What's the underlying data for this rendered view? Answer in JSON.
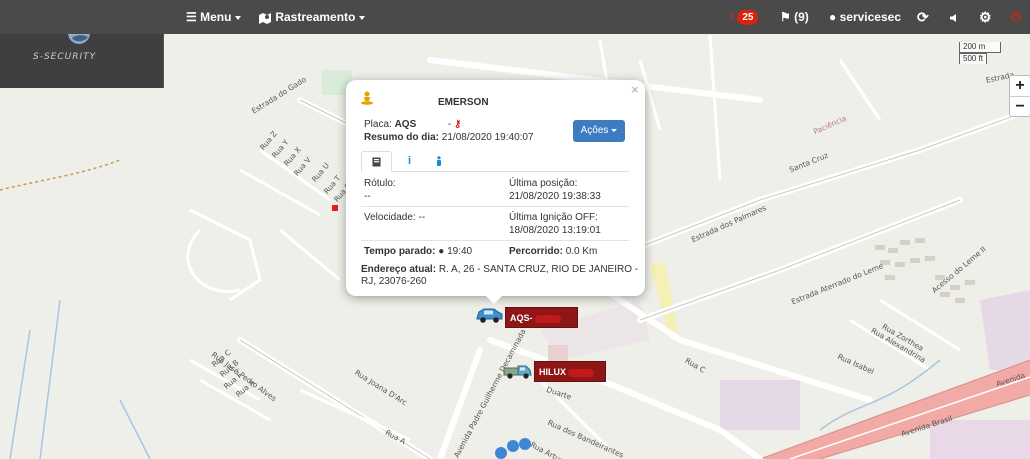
{
  "topbar": {
    "menu_label": "Menu",
    "rastreamento_label": "Rastreamento",
    "alerts_count": "25",
    "flags_label": "(9)",
    "user_label": "servicesec",
    "colors": {
      "bar": "#4a4a4a",
      "badge": "#d9230f"
    }
  },
  "logo": {
    "text": "S-SECURITY"
  },
  "scale": {
    "metric": "200 m",
    "imperial": "500 ft"
  },
  "zoom": {
    "in": "+",
    "out": "−"
  },
  "popup": {
    "close": "×",
    "name": "EMERSON",
    "placa_label": "Placa:",
    "placa_value": "AQS",
    "placa_suffix": "-",
    "resumo_label": "Resumo do dia:",
    "resumo_value": "21/08/2020 19:40:07",
    "acoes_label": "Ações",
    "rotulo_label": "Rótulo:",
    "rotulo_value": "--",
    "ultima_posicao_label": "Última posição:",
    "ultima_posicao_value": "21/08/2020 19:38:33",
    "velocidade_label": "Velocidade:",
    "velocidade_value": "--",
    "ultima_ignicao_label": "Última Ignição OFF:",
    "ultima_ignicao_value": "18/08/2020 13:19:01",
    "tempo_parado_label": "Tempo parado:",
    "tempo_parado_value": "19:40",
    "percorrido_label": "Percorrido:",
    "percorrido_value": "0.0 Km",
    "endereco_label": "Endereço atual:",
    "endereco_value_1": "R. A, 26 - SANTA CRUZ, RIO DE JANEIRO -",
    "endereco_value_2": "RJ, 23076-260"
  },
  "vehicles": [
    {
      "label": "AQS-",
      "color": "#8f1616"
    },
    {
      "label": "HILUX",
      "color": "#8f1616"
    }
  ],
  "streets": [
    "Estrada do Gado",
    "Rua Z",
    "Rua Y",
    "Rua X",
    "Rua V",
    "Rua U",
    "Rua T",
    "Rua S",
    "Estrada dos Palmares",
    "Santa Cruz",
    "Paciência",
    "Estrada",
    "Estrada Aterrado do Leme",
    "Acesso do Leme II",
    "Rua Zorthea",
    "Rua Alexandrina",
    "Rua Isabel",
    "Rua C",
    "Rua José Pedro Alves",
    "Rua C",
    "Rua B",
    "Rua F",
    "Rua A",
    "Rua Joana D'Arc",
    "Rua A",
    "Avenida Padre Guilherme Decaminada",
    "Duarte",
    "Rua dos Bandeirantes",
    "Rua Artur",
    "Avenida Brasil",
    "Avenida"
  ]
}
